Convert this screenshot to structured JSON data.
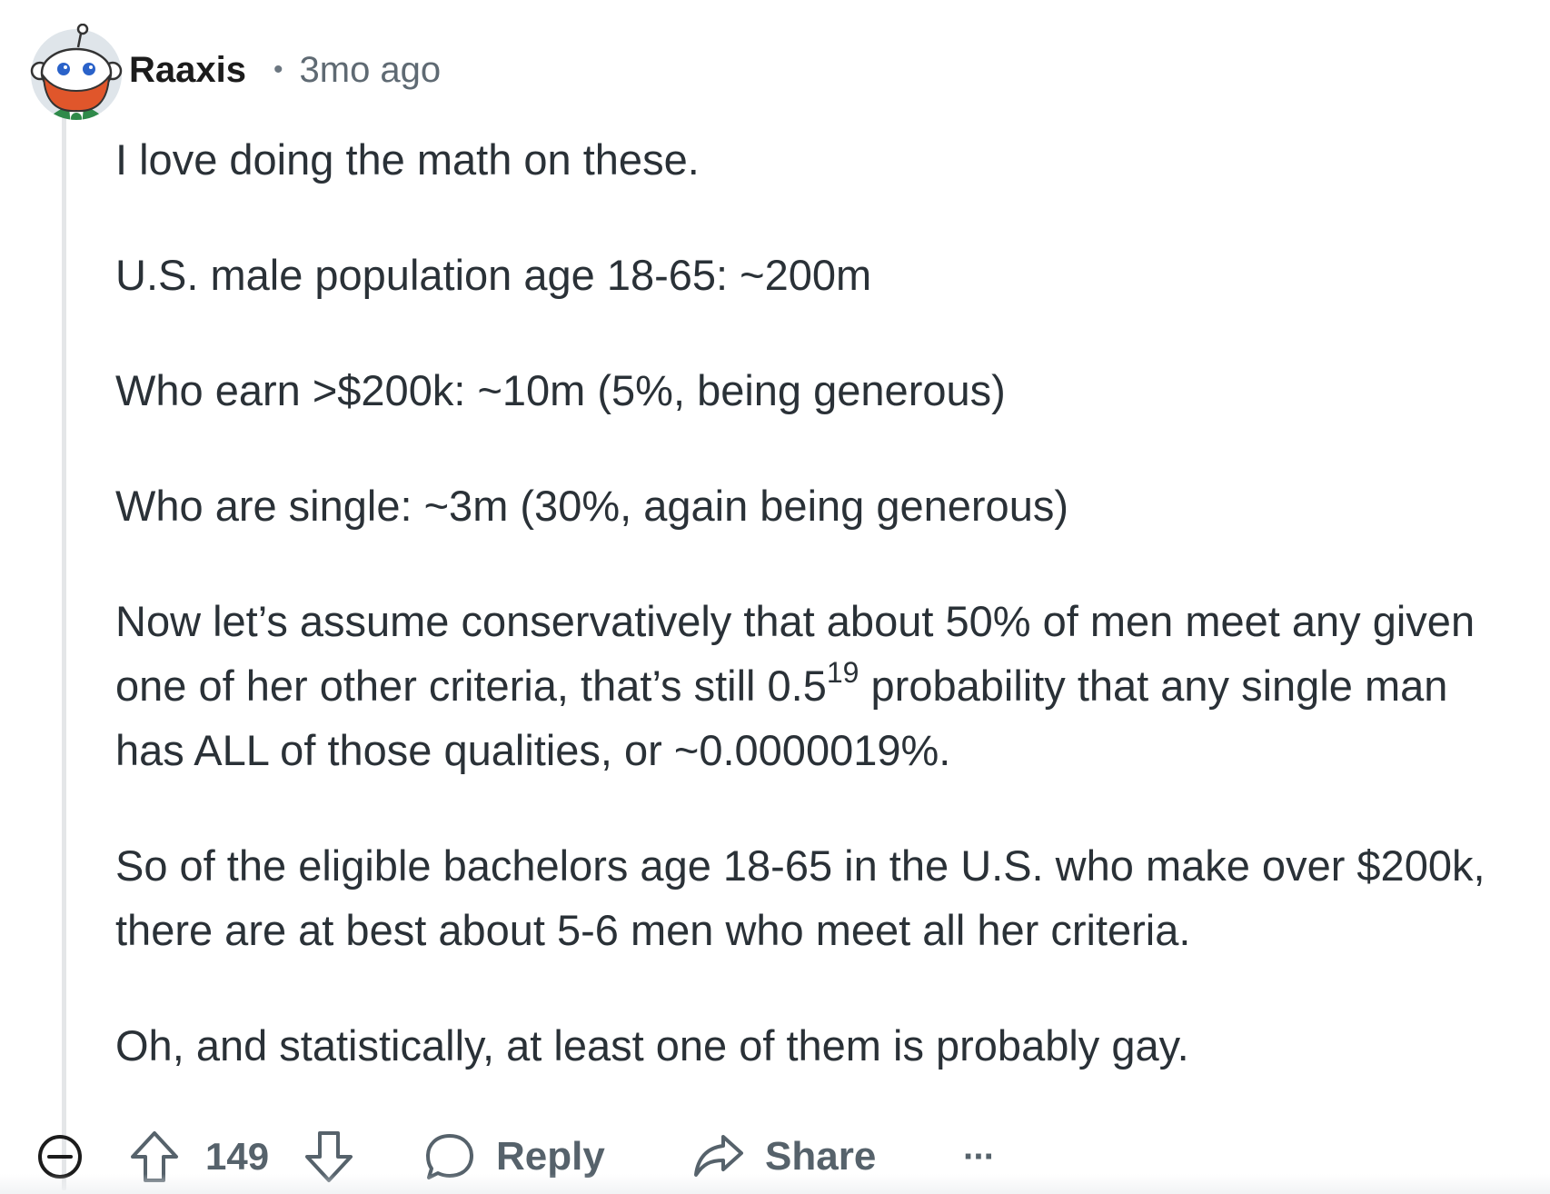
{
  "comment": {
    "author": "Raaxis",
    "separator": "•",
    "timestamp": "3mo ago",
    "paragraphs": {
      "p1": "I love doing the math on these.",
      "p2": "U.S. male population age 18-65: ~200m",
      "p3": "Who earn >$200k: ~10m (5%, being generous)",
      "p4": "Who are single: ~3m (30%, again being generous)",
      "p5_before": "Now let’s assume conservatively that about 50% of men meet any given one of her other criteria, that’s still 0.5",
      "p5_sup": "19",
      "p5_after": " probability that any single man has ALL of those qualities, or ~0.0000019%.",
      "p6": "So of the eligible bachelors age 18-65 in the U.S. who make over $200k, there are at best about 5-6 men who meet all her criteria.",
      "p7": "Oh, and statistically, at least one of them is probably gay."
    }
  },
  "actions": {
    "collapse_icon": "minus-circle-icon",
    "upvote_icon": "arrow-up-icon",
    "score": "149",
    "downvote_icon": "arrow-down-icon",
    "reply_icon": "speech-bubble-icon",
    "reply_label": "Reply",
    "share_icon": "share-arrow-icon",
    "share_label": "Share",
    "more_label": "···"
  },
  "colors": {
    "text": "#2a3137",
    "muted": "#5f6a73",
    "action": "#56626b",
    "avatar_bg": "#dfe5ea",
    "beard": "#e0562b"
  }
}
